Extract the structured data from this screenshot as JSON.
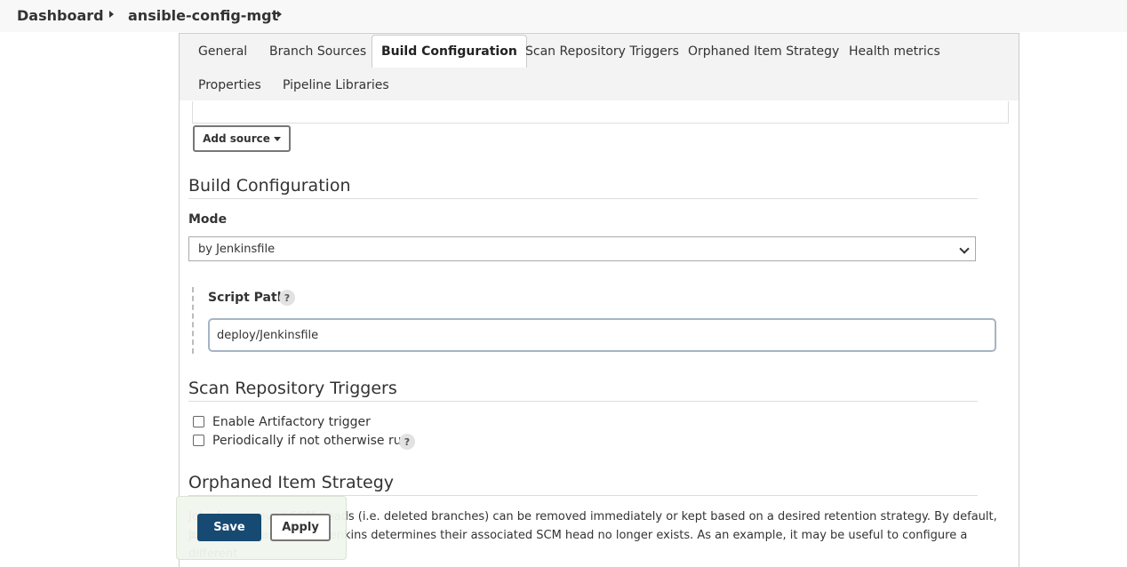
{
  "breadcrumb": {
    "items": [
      "Dashboard",
      "ansible-config-mgt"
    ]
  },
  "tabs": [
    {
      "label": "General",
      "active": false
    },
    {
      "label": "Branch Sources",
      "active": false
    },
    {
      "label": "Build Configuration",
      "active": true
    },
    {
      "label": "Scan Repository Triggers",
      "active": false
    },
    {
      "label": "Orphaned Item Strategy",
      "active": false
    },
    {
      "label": "Health metrics",
      "active": false
    },
    {
      "label": "Properties",
      "active": false
    },
    {
      "label": "Pipeline Libraries",
      "active": false
    }
  ],
  "branch_sources": {
    "add_source_label": "Add source"
  },
  "build_configuration": {
    "title": "Build Configuration",
    "mode_label": "Mode",
    "mode_value": "by Jenkinsfile",
    "script_path_label": "Script Path",
    "script_path_value": "deploy/Jenkinsfile",
    "help_glyph": "?"
  },
  "scan_triggers": {
    "title": "Scan Repository Triggers",
    "options": [
      {
        "label": "Enable Artifactory trigger",
        "checked": false,
        "has_help": false
      },
      {
        "label": "Periodically if not otherwise run",
        "checked": false,
        "has_help": true
      }
    ]
  },
  "orphaned": {
    "title": "Orphaned Item Strategy",
    "desc_line1": "Jobs for removed SCM heads (i.e. deleted branches) can be removed immediately or kept based on a desired retention strategy. By default, jobs will",
    "desc_line2": "be removed as soon as Jenkins determines their associated SCM head no longer exists. As an example, it may be useful to configure a different"
  },
  "actions": {
    "save_label": "Save",
    "apply_label": "Apply"
  },
  "colors": {
    "save_bg": "#164a72",
    "tabbar_bg": "#f3f3f3"
  }
}
